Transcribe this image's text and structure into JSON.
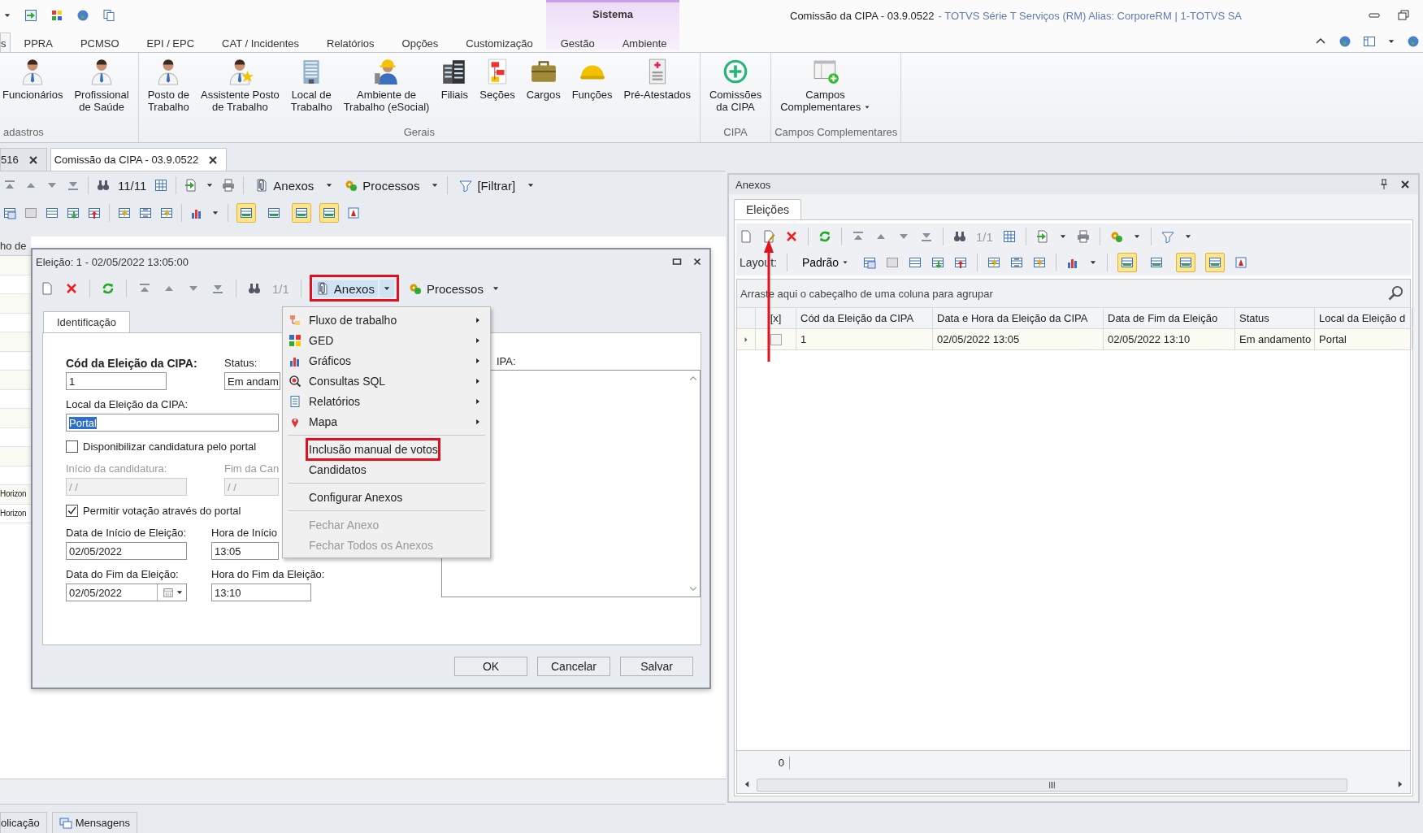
{
  "context_tab_group": {
    "label": "Sistema"
  },
  "window_title": {
    "document": "Comissão da CIPA - 03.9.0522",
    "application": "- TOTVS Série T Serviços (RM) Alias: CorporeRM | 1-TOTVS SA"
  },
  "ribbon_tabs": [
    {
      "label": "s",
      "selected": true
    },
    {
      "label": "PPRA",
      "selected": false
    },
    {
      "label": "PCMSO",
      "selected": false
    },
    {
      "label": "EPI / EPC",
      "selected": false
    },
    {
      "label": "CAT / Incidentes",
      "selected": false
    },
    {
      "label": "Relatórios",
      "selected": false
    },
    {
      "label": "Opções",
      "selected": false
    },
    {
      "label": "Customização",
      "selected": false
    },
    {
      "label": "Gestão",
      "selected": false
    },
    {
      "label": "Ambiente",
      "selected": false
    }
  ],
  "ribbon_groups": [
    {
      "label": "adastros",
      "buttons": [
        {
          "label": "Funcionários",
          "dropdown": false
        },
        {
          "label": "Profissional\nde Saúde",
          "dropdown": false
        }
      ]
    },
    {
      "label": "Gerais",
      "buttons": [
        {
          "label": "Posto de\nTrabalho",
          "dropdown": false
        },
        {
          "label": "Assistente Posto\nde Trabalho",
          "dropdown": false
        },
        {
          "label": "Local de\nTrabalho",
          "dropdown": false
        },
        {
          "label": "Ambiente de\nTrabalho (eSocial)",
          "dropdown": false
        },
        {
          "label": "Filiais",
          "dropdown": false
        },
        {
          "label": "Seções",
          "dropdown": false
        },
        {
          "label": "Cargos",
          "dropdown": false
        },
        {
          "label": "Funções",
          "dropdown": false
        },
        {
          "label": "Pré-Atestados",
          "dropdown": false
        }
      ]
    },
    {
      "label": "CIPA",
      "buttons": [
        {
          "label": "Comissões\nda CIPA",
          "dropdown": false
        }
      ]
    },
    {
      "label": "Campos Complementares",
      "buttons": [
        {
          "label": "Campos\nComplementares",
          "dropdown": true
        }
      ]
    }
  ],
  "document_tabs": [
    {
      "label": "516",
      "selected": false
    },
    {
      "label": "Comissão da CIPA - 03.9.0522",
      "selected": true
    }
  ],
  "main_toolbar": {
    "record_counter": "11/11",
    "buttons": [
      {
        "label": "Anexos"
      },
      {
        "label": "Processos"
      },
      {
        "label": "[Filtrar]"
      }
    ],
    "view_toggles": [
      {
        "selected": true
      },
      {
        "selected": false
      },
      {
        "selected": true
      },
      {
        "selected": true
      }
    ]
  },
  "background_grid": {
    "header": "ho de",
    "rows": [
      "Horizon",
      "Horizon"
    ]
  },
  "dialog": {
    "title": "Eleição: 1 - 02/05/2022 13:05:00",
    "record_counter": "1/1",
    "buttons": [
      {
        "label": "Anexos",
        "annotated": true
      },
      {
        "label": "Processos",
        "annotated": false
      }
    ],
    "tabs": [
      {
        "label": "Identificação",
        "selected": true
      }
    ],
    "form": [
      {
        "kind": "fields",
        "fields": [
          {
            "label": "Cód da Eleição da CIPA:",
            "value": "1",
            "bold": true,
            "disabled": false
          },
          {
            "label": "Status:",
            "value": "Em andam",
            "bold": false,
            "disabled": false
          }
        ]
      },
      {
        "kind": "fields",
        "fields": [
          {
            "label": "Local da Eleição da CIPA:",
            "value": "Portal",
            "bold": false,
            "disabled": false,
            "text_selected": true
          }
        ]
      },
      {
        "kind": "checkbox",
        "label": "Disponibilizar candidatura pelo portal",
        "checked": false
      },
      {
        "kind": "fields",
        "fields": [
          {
            "label": "Início da candidatura:",
            "value": "/ /",
            "bold": false,
            "disabled": true
          },
          {
            "label": "Fim da Can",
            "value": "/ /",
            "bold": false,
            "disabled": true
          }
        ]
      },
      {
        "kind": "checkbox",
        "label": "Permitir votação através do portal",
        "checked": true
      },
      {
        "kind": "fields",
        "fields": [
          {
            "label": "Data de Início de Eleição:",
            "value": "02/05/2022",
            "bold": false,
            "disabled": false
          },
          {
            "label": "Hora de Início",
            "value": "13:05",
            "bold": false,
            "disabled": false
          }
        ]
      },
      {
        "kind": "fields",
        "fields": [
          {
            "label": "Data do Fim da Eleição:",
            "value": "02/05/2022",
            "bold": false,
            "disabled": false,
            "calendar": true
          },
          {
            "label": "Hora do Fim da Eleição:",
            "value": "13:10",
            "bold": false,
            "disabled": false
          }
        ]
      }
    ],
    "notes_label": "IPA:",
    "actions": [
      "OK",
      "Cancelar",
      "Salvar"
    ]
  },
  "context_menu": [
    {
      "label": "Fluxo de trabalho",
      "submenu": true,
      "disabled": false,
      "annotated": false,
      "separator_before": false
    },
    {
      "label": "GED",
      "submenu": true,
      "disabled": false,
      "annotated": false,
      "separator_before": false
    },
    {
      "label": "Gráficos",
      "submenu": true,
      "disabled": false,
      "annotated": false,
      "separator_before": false
    },
    {
      "label": "Consultas SQL",
      "submenu": true,
      "disabled": false,
      "annotated": false,
      "separator_before": false
    },
    {
      "label": "Relatórios",
      "submenu": true,
      "disabled": false,
      "annotated": false,
      "separator_before": false
    },
    {
      "label": "Mapa",
      "submenu": true,
      "disabled": false,
      "annotated": false,
      "separator_before": false
    },
    {
      "label": "Inclusão manual de votos",
      "submenu": false,
      "disabled": false,
      "annotated": true,
      "separator_before": true
    },
    {
      "label": "Candidatos",
      "submenu": false,
      "disabled": false,
      "annotated": false,
      "separator_before": false
    },
    {
      "label": "Configurar Anexos",
      "submenu": false,
      "disabled": false,
      "annotated": false,
      "separator_before": true
    },
    {
      "label": "Fechar Anexo",
      "submenu": false,
      "disabled": true,
      "annotated": false,
      "separator_before": true
    },
    {
      "label": "Fechar Todos os Anexos",
      "submenu": false,
      "disabled": true,
      "annotated": false,
      "separator_before": false
    }
  ],
  "anexos_panel": {
    "title": "Anexos",
    "tabs": [
      {
        "label": "Eleições",
        "selected": true
      }
    ],
    "record_counter": "1/1",
    "edit_annotated": true,
    "layout_label": "Layout:",
    "layout_value": "Padrão",
    "view_toggles": [
      {
        "selected": true
      },
      {
        "selected": false
      },
      {
        "selected": true
      },
      {
        "selected": true
      }
    ],
    "group_hint": "Arraste aqui o cabeçalho de uma coluna para agrupar",
    "checkbox_column": "[x]",
    "columns": [
      "Cód da Eleição da CIPA",
      "Data e Hora da Eleição da CIPA",
      "Data de Fim da Eleição",
      "Status",
      "Local da Eleição d"
    ],
    "rows": [
      {
        "checked": false,
        "cells": [
          "1",
          "02/05/2022 13:05",
          "02/05/2022 13:10",
          "Em andamento",
          "Portal"
        ]
      }
    ],
    "footer_count": "0"
  },
  "bottom_tabs": [
    {
      "label": "olicação"
    },
    {
      "label": "Mensagens"
    }
  ]
}
